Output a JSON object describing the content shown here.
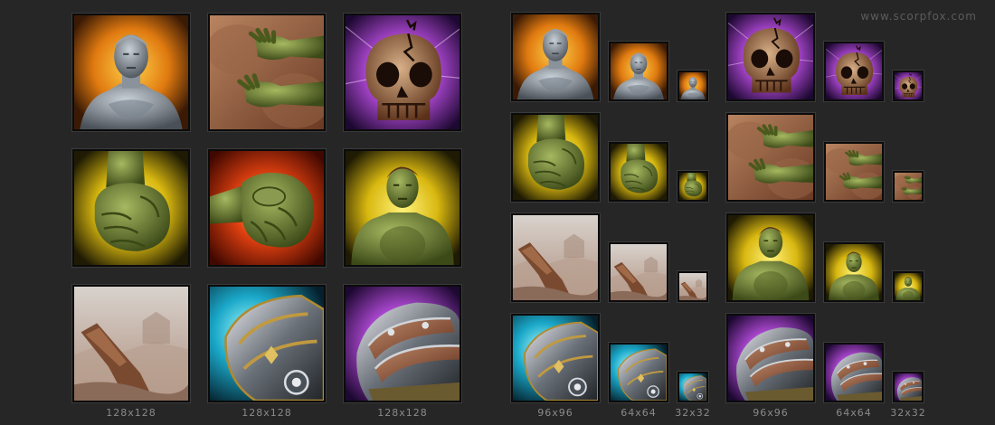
{
  "watermark": "www.scorpfox.com",
  "size_labels": {
    "s128": "128x128",
    "s96": "96x96",
    "s64": "64x64",
    "s32": "32x32"
  },
  "icons": [
    {
      "id": "stone-statue",
      "name": "stone-statue-icon"
    },
    {
      "id": "green-hands-chest",
      "name": "green-hands-on-chest-icon"
    },
    {
      "id": "cracked-skull",
      "name": "cracked-skull-icon"
    },
    {
      "id": "yellow-fist",
      "name": "green-fist-yellow-glow-icon"
    },
    {
      "id": "red-fist",
      "name": "green-fist-red-glow-icon"
    },
    {
      "id": "green-brute",
      "name": "green-brute-icon"
    },
    {
      "id": "rock-landscape",
      "name": "rock-landscape-icon"
    },
    {
      "id": "armor-blue",
      "name": "armor-shoulder-blue-icon"
    },
    {
      "id": "armor-purple",
      "name": "armor-shoulder-purple-icon"
    }
  ]
}
